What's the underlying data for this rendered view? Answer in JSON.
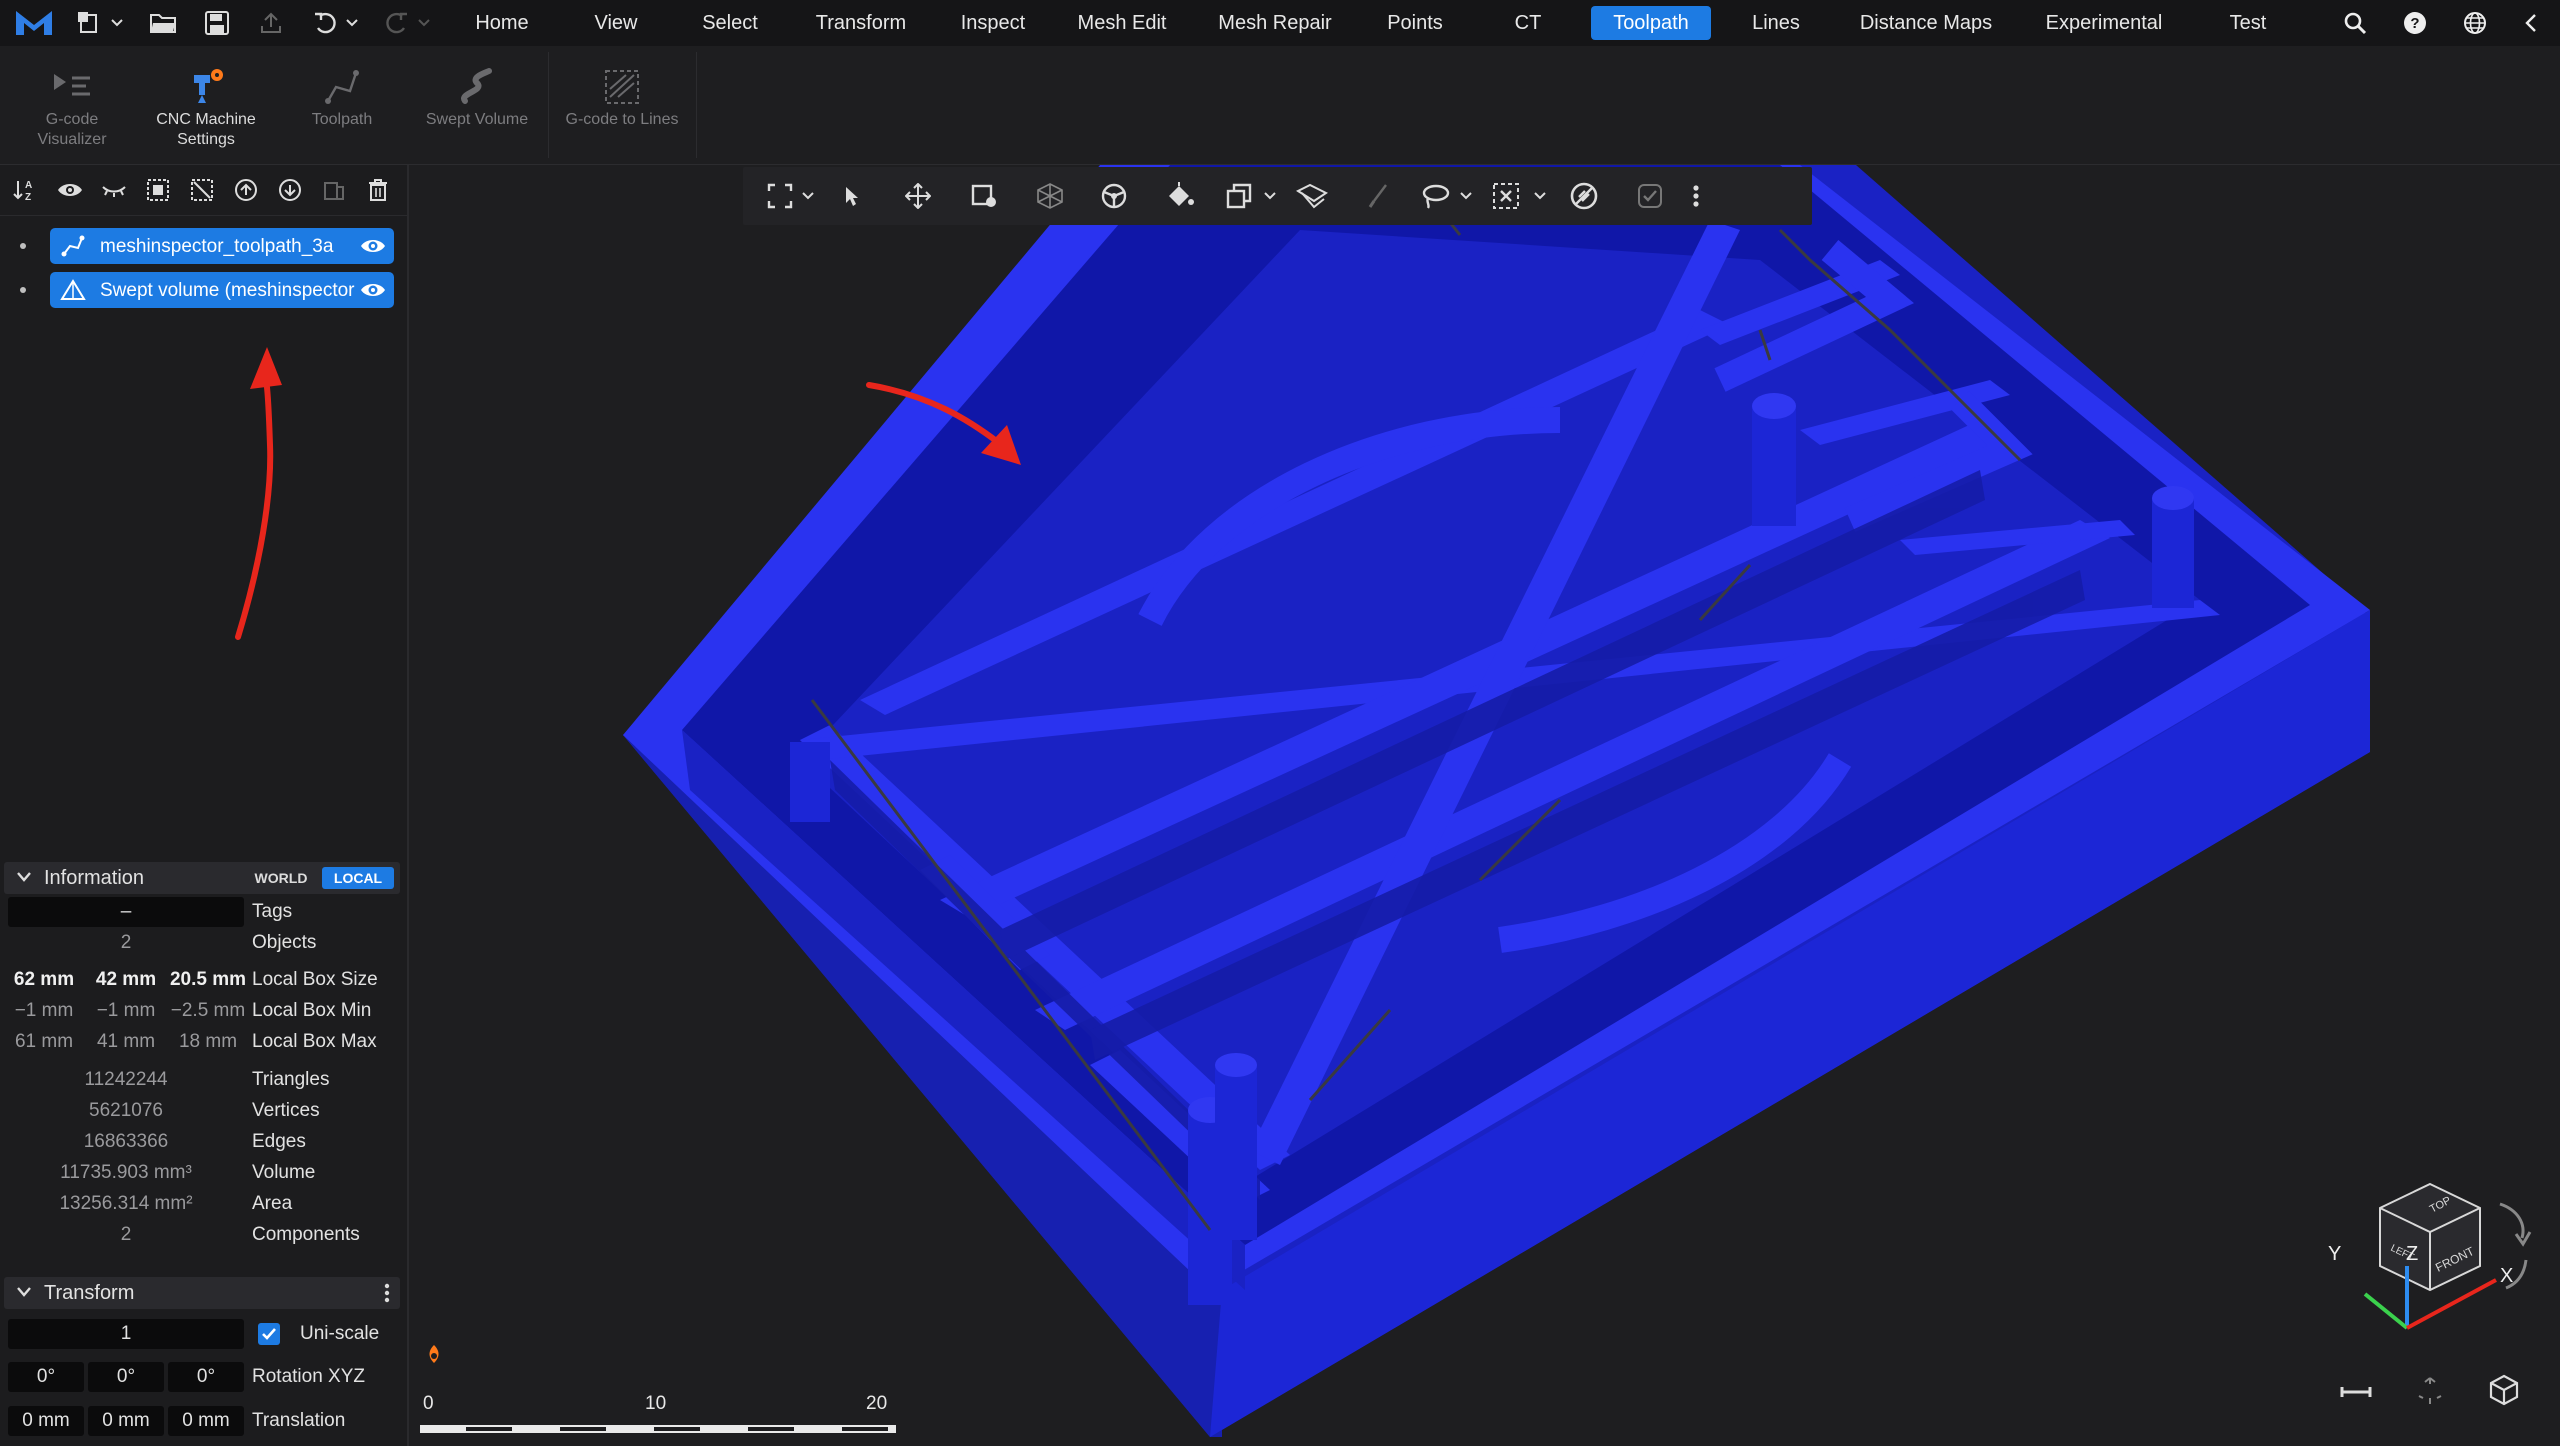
{
  "menu": {
    "items": [
      "Home",
      "View",
      "Select",
      "Transform",
      "Inspect",
      "Mesh Edit",
      "Mesh Repair",
      "Points",
      "CT",
      "Toolpath",
      "Lines",
      "Distance Maps",
      "Experimental",
      "Test"
    ],
    "active": "Toolpath"
  },
  "topbar_icons": [
    "app-logo-icon",
    "new-file-icon",
    "chevron-down-icon",
    "open-folder-icon",
    "save-icon",
    "export-icon",
    "undo-icon",
    "chevron-down-icon",
    "redo-icon",
    "chevron-down-icon",
    "search-icon",
    "help-icon",
    "globe-icon",
    "collapse-icon"
  ],
  "ribbon": {
    "buttons": [
      {
        "label_line1": "G-code",
        "label_line2": "Visualizer",
        "icon": "gcode-visualizer-icon",
        "enabled": false
      },
      {
        "label_line1": "CNC Machine",
        "label_line2": "Settings",
        "icon": "cnc-machine-settings-icon",
        "enabled": true
      },
      {
        "label_line1": "Toolpath",
        "label_line2": "",
        "icon": "toolpath-icon",
        "enabled": false
      },
      {
        "label_line1": "Swept Volume",
        "label_line2": "",
        "icon": "swept-volume-icon",
        "enabled": false
      },
      {
        "label_line1": "G-code to Lines",
        "label_line2": "",
        "icon": "gcode-to-lines-icon",
        "enabled": false
      }
    ]
  },
  "scene_toolbar_icons": [
    "sort-az-icon",
    "show-icon",
    "hide-icon",
    "select-all-icon",
    "deselect-icon",
    "move-up-icon",
    "move-down-icon",
    "duplicate-icon",
    "delete-icon"
  ],
  "scene_tree": {
    "items": [
      {
        "label": "meshinspector_toolpath_3a",
        "icon": "toolpath-object-icon",
        "selected": true,
        "visible": true
      },
      {
        "label": "Swept volume (meshinspector",
        "icon": "mesh-object-icon",
        "selected": true,
        "visible": true
      }
    ]
  },
  "information": {
    "title": "Information",
    "toggle_world": "WORLD",
    "toggle_local": "LOCAL",
    "active_toggle": "LOCAL",
    "tags_value": "–",
    "tags_label": "Tags",
    "objects_value": "2",
    "objects_label": "Objects",
    "box_size": [
      "62 mm",
      "42 mm",
      "20.5 mm"
    ],
    "box_size_label": "Local Box Size",
    "box_min": [
      "−1 mm",
      "−1 mm",
      "−2.5 mm"
    ],
    "box_min_label": "Local Box Min",
    "box_max": [
      "61 mm",
      "41 mm",
      "18 mm"
    ],
    "box_max_label": "Local Box Max",
    "triangles_value": "11242244",
    "triangles_label": "Triangles",
    "vertices_value": "5621076",
    "vertices_label": "Vertices",
    "edges_value": "16863366",
    "edges_label": "Edges",
    "volume_value": "11735.903 mm³",
    "volume_label": "Volume",
    "area_value": "13256.314 mm²",
    "area_label": "Area",
    "components_value": "2",
    "components_label": "Components"
  },
  "transform": {
    "title": "Transform",
    "scale_value": "1",
    "uniscale_label": "Uni-scale",
    "uniscale_checked": true,
    "rotation": [
      "0°",
      "0°",
      "0°"
    ],
    "rotation_label": "Rotation XYZ",
    "translation": [
      "0 mm",
      "0 mm",
      "0 mm"
    ],
    "translation_label": "Translation"
  },
  "viewport_toolbar_icons": [
    "fit-view-icon",
    "chevron-down-icon",
    "select-cursor-icon",
    "move-icon",
    "select-region-icon",
    "wireframe-icon",
    "steering-icon",
    "paint-bucket-icon",
    "copy-icon",
    "chevron-down-icon",
    "clipping-icon",
    "brush-icon",
    "lasso-icon",
    "chevron-down-icon",
    "box-select-icon",
    "chevron-down-icon",
    "no-entry-icon",
    "checkbox-icon",
    "more-vertical-icon"
  ],
  "ruler": {
    "labels": [
      "0",
      "10",
      "20"
    ]
  },
  "view_cube": {
    "axis_x": "X",
    "axis_y": "Y",
    "axis_z": "Z",
    "face_top": "TOP",
    "face_front": "FRONT",
    "face_left": "LEFT"
  },
  "colors": {
    "accent": "#1d7be3",
    "mesh_blue": "#2a33f0",
    "annotation_red": "#e8261c",
    "background": "#1e1e20"
  }
}
